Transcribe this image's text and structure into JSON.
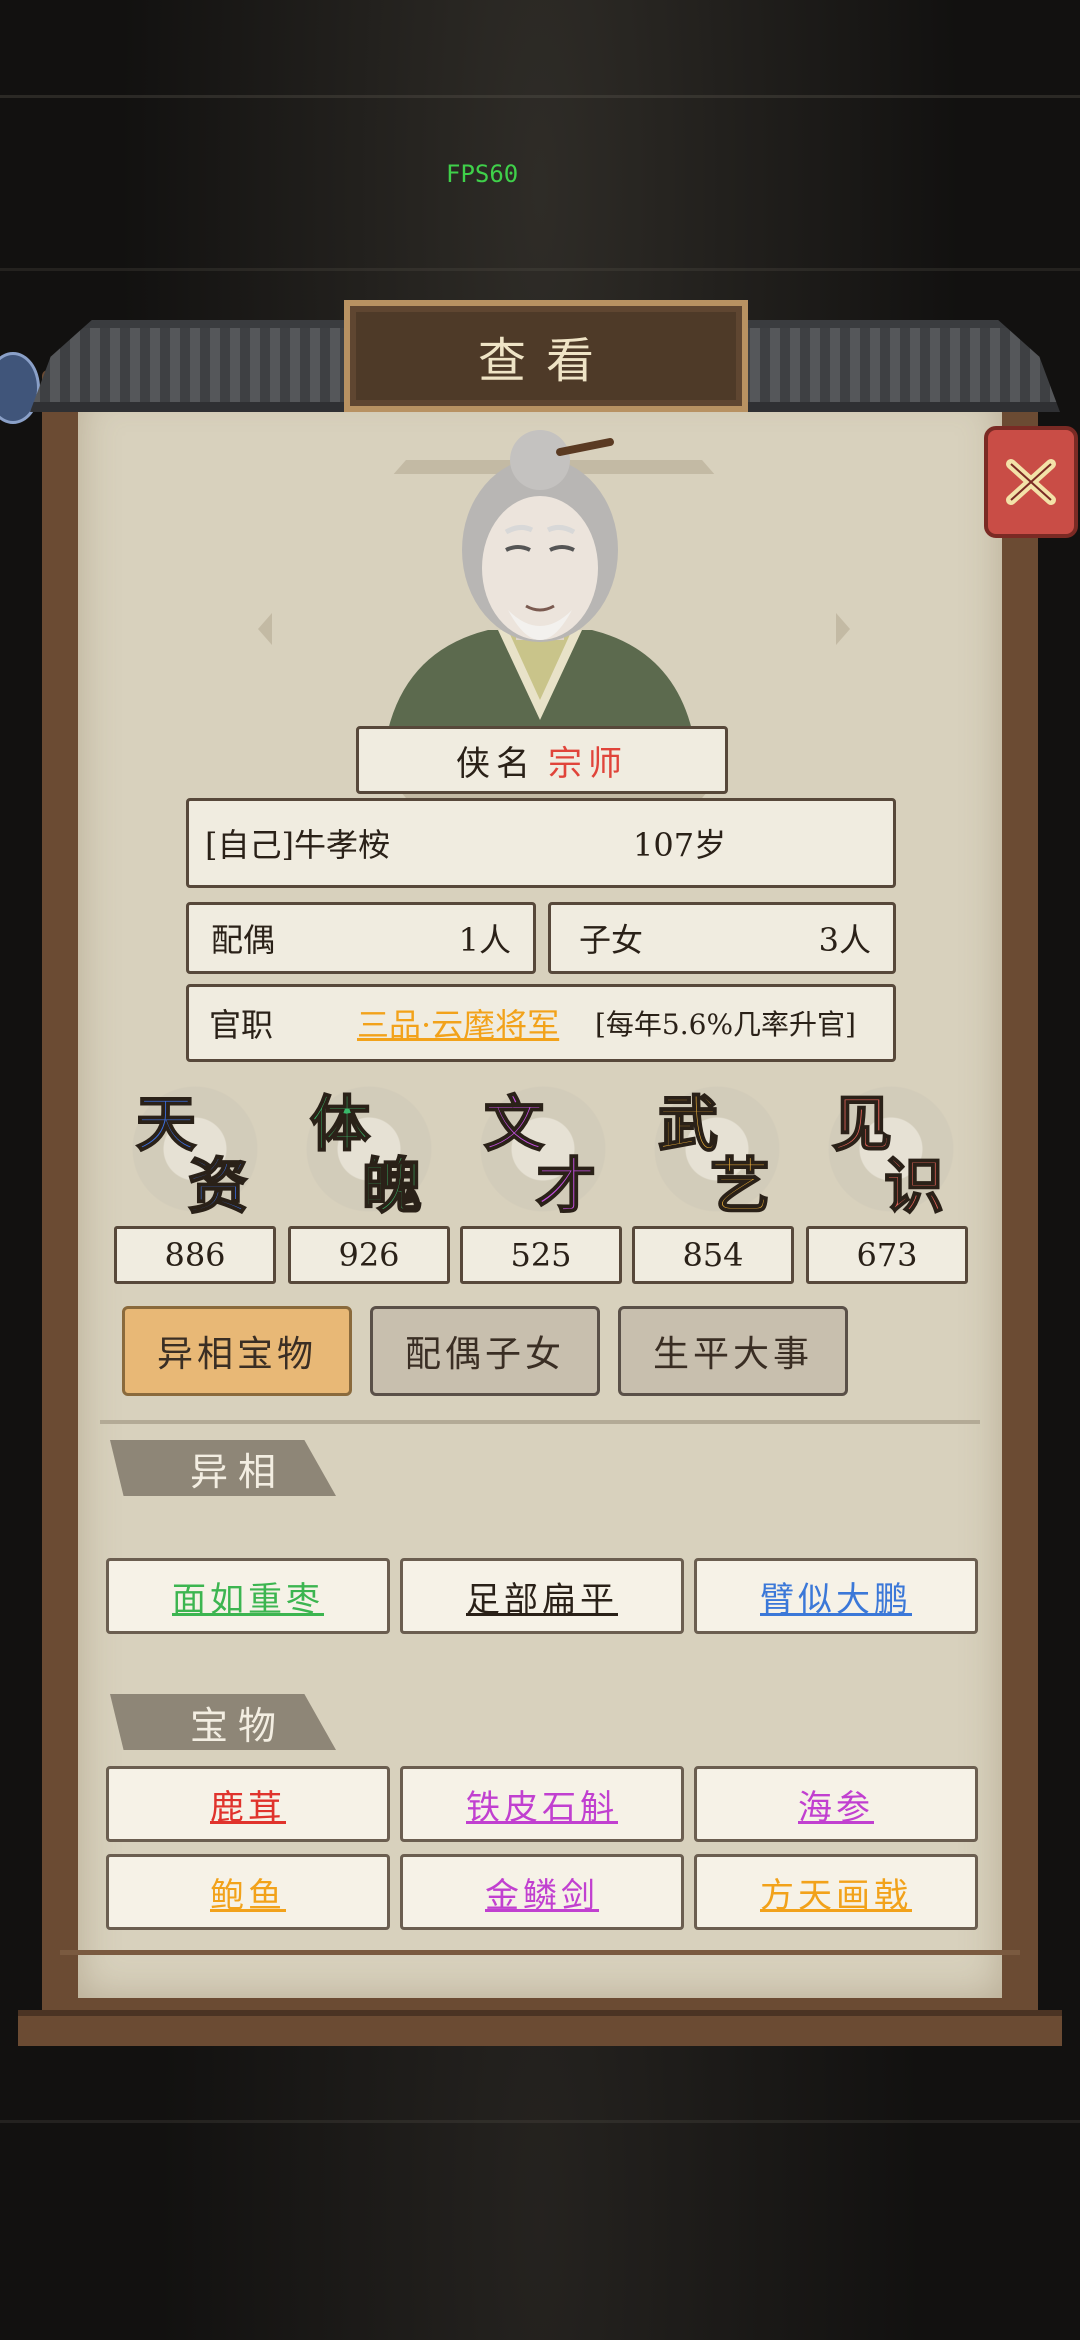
{
  "overlay": {
    "fps": "FPS60"
  },
  "panel": {
    "title": "查看",
    "close_icon": "close-x-icon"
  },
  "profile": {
    "title_prefix": "侠名",
    "title_value": "宗师",
    "title_value_color": "#e0443a",
    "name": "[自己]牛孝桉",
    "age": "107岁",
    "spouse_label": "配偶",
    "spouse_count": "1人",
    "children_label": "子女",
    "children_count": "3人",
    "office_label": "官职",
    "office_value": "三品·云麾将军",
    "office_value_color": "#f2a21a",
    "office_note": "[每年5.6%几率升官]"
  },
  "stats": [
    {
      "c1": "天",
      "c2": "资",
      "color": "#3b6fe0",
      "value": "886"
    },
    {
      "c1": "体",
      "c2": "魄",
      "color": "#39b86a",
      "value": "926"
    },
    {
      "c1": "文",
      "c2": "才",
      "color": "#c34fe0",
      "value": "525"
    },
    {
      "c1": "武",
      "c2": "艺",
      "color": "#f0b23a",
      "value": "854"
    },
    {
      "c1": "见",
      "c2": "识",
      "color": "#e8645a",
      "value": "673"
    }
  ],
  "tabs": [
    {
      "label": "异相宝物"
    },
    {
      "label": "配偶子女"
    },
    {
      "label": "生平大事"
    }
  ],
  "sections": {
    "traits_title": "异相",
    "treasures_title": "宝物"
  },
  "traits": [
    {
      "label": "面如重枣",
      "color": "#3cb550"
    },
    {
      "label": "足部扁平",
      "color": "#2a2118"
    },
    {
      "label": "臂似大鹏",
      "color": "#3b78d8"
    }
  ],
  "treasures": [
    {
      "label": "鹿茸",
      "color": "#e0332c"
    },
    {
      "label": "铁皮石斛",
      "color": "#c140d0"
    },
    {
      "label": "海参",
      "color": "#c140d0"
    },
    {
      "label": "鲍鱼",
      "color": "#f2a21a"
    },
    {
      "label": "金鳞剑",
      "color": "#c140d0"
    },
    {
      "label": "方天画戟",
      "color": "#f2a21a"
    }
  ]
}
